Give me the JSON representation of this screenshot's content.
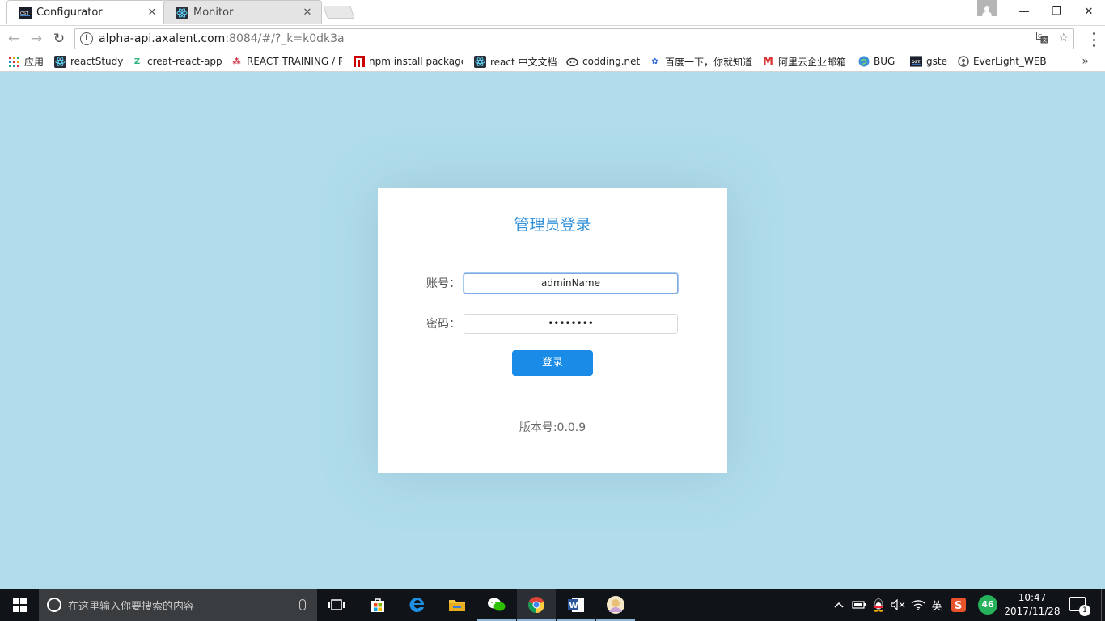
{
  "browser": {
    "tabs": [
      {
        "title": "Configurator",
        "favicon": "ost-icon",
        "active": true
      },
      {
        "title": "Monitor",
        "favicon": "react-icon",
        "active": false
      }
    ],
    "close_glyph": "✕",
    "window_controls": {
      "minimize": "—",
      "restore": "❐",
      "close": "✕"
    },
    "url_host": "alpha-api.axalent.com",
    "url_rest": ":8084/#/?_k=k0dk3a",
    "nav": {
      "back": "←",
      "forward": "→",
      "reload": "↻"
    },
    "bookmarks": [
      {
        "label": "应用",
        "icon": "apps-grid-icon"
      },
      {
        "label": "reactStudy",
        "icon": "react-icon"
      },
      {
        "label": "creat-react-app",
        "icon": "zhihu-icon"
      },
      {
        "label": "REACT TRAINING / R",
        "icon": "react-training-icon"
      },
      {
        "label": "npm  install package",
        "icon": "npm-icon"
      },
      {
        "label": "react 中文文档",
        "icon": "react-icon"
      },
      {
        "label": "codding.net",
        "icon": "coding-icon"
      },
      {
        "label": "百度一下，你就知道",
        "icon": "baidu-icon"
      },
      {
        "label": "阿里云企业邮箱",
        "icon": "aliyun-mail-icon"
      },
      {
        "label": "BUG",
        "icon": "globe-icon"
      },
      {
        "label": "gste",
        "icon": "ost-icon"
      },
      {
        "label": "EverLight_WEB",
        "icon": "location-pin-icon"
      }
    ],
    "bookmarks_more": "»"
  },
  "login": {
    "title": "管理员登录",
    "account_label": "账号：",
    "account_value": "adminName",
    "password_label": "密码：",
    "password_value": "••••••••",
    "submit_label": "登录",
    "version_text": "版本号:0.0.9"
  },
  "colors": {
    "page_background": "#b0dceb",
    "accent": "#1a8be6",
    "title": "#2f8fd8"
  },
  "taskbar": {
    "search_placeholder": "在这里输入你要搜索的内容",
    "apps": [
      "task-view-icon",
      "store-icon",
      "edge-icon",
      "file-explorer-icon",
      "wechat-icon",
      "chrome-icon",
      "word-icon",
      "app-avatar-icon"
    ],
    "tray": {
      "input_method": "英",
      "network_badge": "46"
    },
    "clock": {
      "time": "10:47",
      "date": "2017/11/28"
    },
    "notifications_count": "1"
  }
}
